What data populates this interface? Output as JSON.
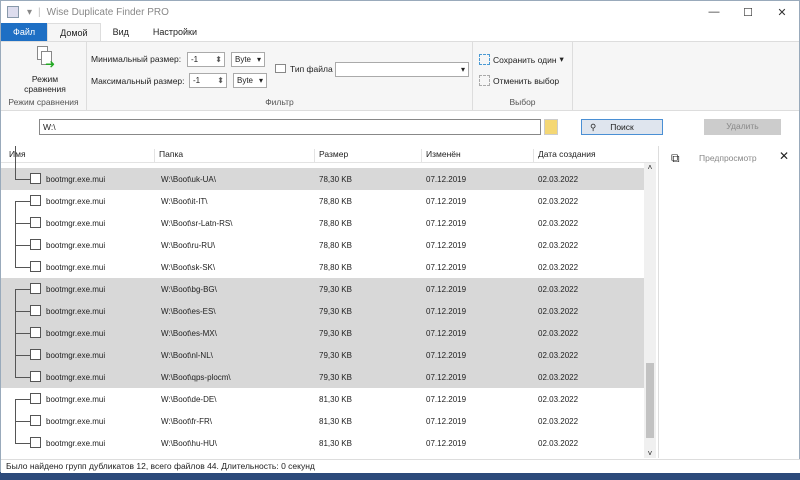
{
  "app": {
    "title": "Wise Duplicate Finder PRO"
  },
  "tabs": [
    "Файл",
    "Домой",
    "Вид",
    "Настройки"
  ],
  "ribbon": {
    "compare_mode_button": "Режим сравнения",
    "compare_group": "Режим сравнения",
    "min_size_label": "Минимальный размер:",
    "min_size_value": "-1",
    "min_unit": "Byte",
    "max_size_label": "Максимальный размер:",
    "max_size_value": "-1",
    "max_unit": "Byte",
    "file_type_label": "Тип файла",
    "file_type_value": "",
    "filter_group": "Фильтр",
    "keep_one": "Сохранить один",
    "deselect": "Отменить выбор",
    "select_group": "Выбор"
  },
  "search": {
    "path": "W:\\",
    "search_button": "Поиск",
    "delete_button": "Удалить"
  },
  "table": {
    "columns": [
      "Имя",
      "Папка",
      "Размер",
      "Изменён",
      "Дата создания"
    ],
    "rows": [
      {
        "name": "bootmgr.exe.mui",
        "folder": "W:\\Boot\\uk-UA\\",
        "size": "78,30 KB",
        "modified": "07.12.2019",
        "created": "02.03.2022"
      },
      {
        "name": "bootmgr.exe.mui",
        "folder": "W:\\Boot\\it-IT\\",
        "size": "78,80 KB",
        "modified": "07.12.2019",
        "created": "02.03.2022"
      },
      {
        "name": "bootmgr.exe.mui",
        "folder": "W:\\Boot\\sr-Latn-RS\\",
        "size": "78,80 KB",
        "modified": "07.12.2019",
        "created": "02.03.2022"
      },
      {
        "name": "bootmgr.exe.mui",
        "folder": "W:\\Boot\\ru-RU\\",
        "size": "78,80 KB",
        "modified": "07.12.2019",
        "created": "02.03.2022"
      },
      {
        "name": "bootmgr.exe.mui",
        "folder": "W:\\Boot\\sk-SK\\",
        "size": "78,80 KB",
        "modified": "07.12.2019",
        "created": "02.03.2022"
      },
      {
        "name": "bootmgr.exe.mui",
        "folder": "W:\\Boot\\bg-BG\\",
        "size": "79,30 KB",
        "modified": "07.12.2019",
        "created": "02.03.2022"
      },
      {
        "name": "bootmgr.exe.mui",
        "folder": "W:\\Boot\\es-ES\\",
        "size": "79,30 KB",
        "modified": "07.12.2019",
        "created": "02.03.2022"
      },
      {
        "name": "bootmgr.exe.mui",
        "folder": "W:\\Boot\\es-MX\\",
        "size": "79,30 KB",
        "modified": "07.12.2019",
        "created": "02.03.2022"
      },
      {
        "name": "bootmgr.exe.mui",
        "folder": "W:\\Boot\\nl-NL\\",
        "size": "79,30 KB",
        "modified": "07.12.2019",
        "created": "02.03.2022"
      },
      {
        "name": "bootmgr.exe.mui",
        "folder": "W:\\Boot\\qps-plocm\\",
        "size": "79,30 KB",
        "modified": "07.12.2019",
        "created": "02.03.2022"
      },
      {
        "name": "bootmgr.exe.mui",
        "folder": "W:\\Boot\\de-DE\\",
        "size": "81,30 KB",
        "modified": "07.12.2019",
        "created": "02.03.2022"
      },
      {
        "name": "bootmgr.exe.mui",
        "folder": "W:\\Boot\\fr-FR\\",
        "size": "81,30 KB",
        "modified": "07.12.2019",
        "created": "02.03.2022"
      },
      {
        "name": "bootmgr.exe.mui",
        "folder": "W:\\Boot\\hu-HU\\",
        "size": "81,30 KB",
        "modified": "07.12.2019",
        "created": "02.03.2022"
      }
    ]
  },
  "preview": {
    "label": "Предпросмотр"
  },
  "status": "Было найдено групп дубликатов 12, всего файлов 44. Длительность: 0 секунд"
}
